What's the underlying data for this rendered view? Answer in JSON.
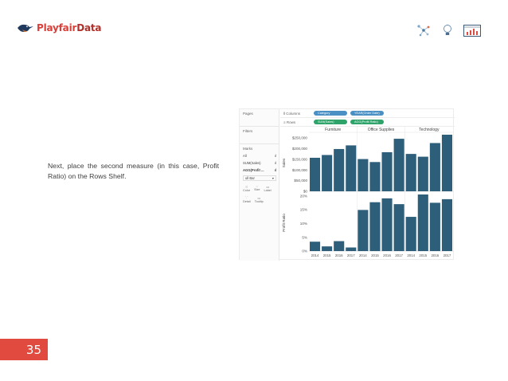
{
  "brand": {
    "name_part1": "Playfair",
    "name_part2": "Data"
  },
  "caption": "Next, place the second measure (in this case, Profit Ratio) on the Rows Shelf.",
  "page_number": "35",
  "tableau": {
    "cards": {
      "pages": "Pages",
      "filters": "Filters",
      "marks": "Marks"
    },
    "marks_items": [
      "All",
      "SUM(Sales)",
      "AGG(Profit ...",
      "ull Bar"
    ],
    "marks_buttons": [
      "Color",
      "Size",
      "Label",
      "Detail",
      "Tooltip"
    ],
    "columns_label": "Columns",
    "rows_label": "Rows",
    "columns_pills": [
      "Category",
      "YEAR(Order Date)"
    ],
    "rows_pills": [
      "SUM(Sales)",
      "AGG(Profit Ratio)"
    ]
  },
  "chart_data": {
    "type": "bar",
    "panels": [
      "Furniture",
      "Office Supplies",
      "Technology"
    ],
    "categories": [
      "2014",
      "2015",
      "2016",
      "2017"
    ],
    "bar_color": "#2e5f7a",
    "series": [
      {
        "name": "Sales",
        "ylabel": "Sales",
        "ylim": [
          0,
          265000
        ],
        "ticks": [
          "$0",
          "$50,000",
          "$100,000",
          "$150,000",
          "$200,000",
          "$250,000"
        ],
        "tick_values": [
          0,
          50000,
          100000,
          150000,
          200000,
          250000
        ],
        "values": [
          [
            157000,
            170000,
            198000,
            215000
          ],
          [
            151000,
            137000,
            183000,
            246000
          ],
          [
            175000,
            162000,
            226000,
            272000
          ]
        ]
      },
      {
        "name": "Profit Ratio",
        "ylabel": "Profit Ratio",
        "ylim": [
          0,
          0.205
        ],
        "ticks": [
          "0%",
          "5%",
          "10%",
          "15%",
          "20%"
        ],
        "tick_values": [
          0,
          0.05,
          0.1,
          0.15,
          0.2
        ],
        "values": [
          [
            0.034,
            0.017,
            0.036,
            0.013
          ],
          [
            0.149,
            0.177,
            0.191,
            0.17
          ],
          [
            0.124,
            0.205,
            0.175,
            0.188
          ]
        ]
      }
    ]
  }
}
